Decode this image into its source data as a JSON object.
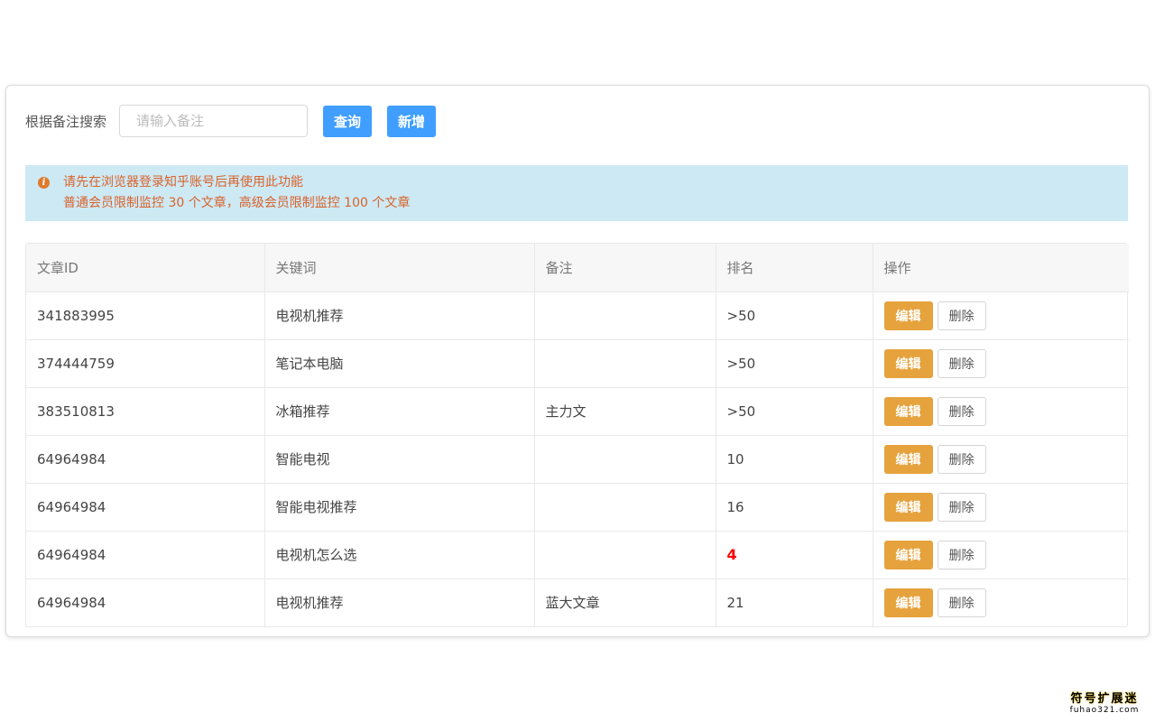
{
  "search": {
    "label": "根据备注搜索",
    "placeholder": "请输入备注",
    "query_button": "查询",
    "add_button": "新增"
  },
  "alert": {
    "line1": "请先在浏览器登录知乎账号后再使用此功能",
    "line2": "普通会员限制监控 30 个文章，高级会员限制监控 100 个文章"
  },
  "table": {
    "headers": [
      "文章ID",
      "关键词",
      "备注",
      "排名",
      "操作"
    ],
    "rows": [
      {
        "id": "341883995",
        "keyword": "电视机推荐",
        "note": "",
        "rank": ">50"
      },
      {
        "id": "374444759",
        "keyword": "笔记本电脑",
        "note": "",
        "rank": ">50"
      },
      {
        "id": "383510813",
        "keyword": "冰箱推荐",
        "note": "主力文",
        "rank": ">50"
      },
      {
        "id": "64964984",
        "keyword": "智能电视",
        "note": "",
        "rank": "10"
      },
      {
        "id": "64964984",
        "keyword": "智能电视推荐",
        "note": "",
        "rank": "16"
      },
      {
        "id": "64964984",
        "keyword": "电视机怎么选",
        "note": "",
        "rank": "4",
        "highlight": true
      },
      {
        "id": "64964984",
        "keyword": "电视机推荐",
        "note": "蓝大文章",
        "rank": "21"
      }
    ],
    "edit_label": "编辑",
    "delete_label": "删除"
  },
  "watermark": {
    "top": "符号扩展迷",
    "bottom": "fuhao321.com"
  },
  "colors": {
    "primary": "#409eff",
    "edit": "#e6a23c",
    "alert_bg": "#cde9f4",
    "alert_text": "#d9622b",
    "rank_highlight": "#ff0000"
  }
}
